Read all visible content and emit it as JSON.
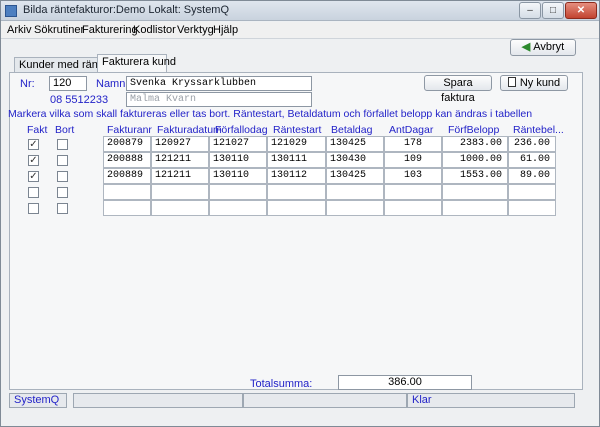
{
  "window": {
    "title": "Bilda räntefakturor:Demo Lokalt: SystemQ"
  },
  "menu": [
    "Arkiv",
    "Sökrutiner",
    "Fakturering",
    "Kodlistor",
    "Verktyg",
    "Hjälp"
  ],
  "toolbar": {
    "cancel_label": "Avbryt"
  },
  "tabs": [
    "Kunder med räntor",
    "Fakturera kund"
  ],
  "customer": {
    "nr_label": "Nr:",
    "nr_value": "120",
    "name_label": "Namn:",
    "name_value": "Svenka Kryssarklubben",
    "phone": "08 5512233",
    "address": "Malma Kvarn"
  },
  "buttons": {
    "save_invoice": "Spara faktura",
    "new_customer": "Ny kund"
  },
  "instruction": "Markera vilka som skall faktureras eller tas bort. Räntestart, Betaldatum och förfallet belopp kan ändras i tabellen",
  "table": {
    "columns": [
      "Fakt",
      "Bort",
      "Fakturanr",
      "Fakturadatum",
      "Förfallodag",
      "Räntestart",
      "Betaldag",
      "AntDagar",
      "FörfBelopp",
      "Räntebel..."
    ],
    "rows": [
      {
        "fakt": true,
        "bort": false,
        "cells": [
          "200879",
          "120927",
          "121027",
          "121029",
          "130425",
          "178",
          "2383.00",
          "236.00"
        ]
      },
      {
        "fakt": true,
        "bort": false,
        "cells": [
          "200888",
          "121211",
          "130110",
          "130111",
          "130430",
          "109",
          "1000.00",
          "61.00"
        ]
      },
      {
        "fakt": true,
        "bort": false,
        "cells": [
          "200889",
          "121211",
          "130110",
          "130112",
          "130425",
          "103",
          "1553.00",
          "89.00"
        ]
      },
      {
        "fakt": false,
        "bort": false,
        "cells": [
          "",
          "",
          "",
          "",
          "",
          "",
          "",
          ""
        ]
      },
      {
        "fakt": false,
        "bort": false,
        "cells": [
          "",
          "",
          "",
          "",
          "",
          "",
          "",
          ""
        ]
      }
    ]
  },
  "total": {
    "label": "Totalsumma:",
    "value": "386.00"
  },
  "status": {
    "left": "SystemQ",
    "right": "Klar"
  }
}
